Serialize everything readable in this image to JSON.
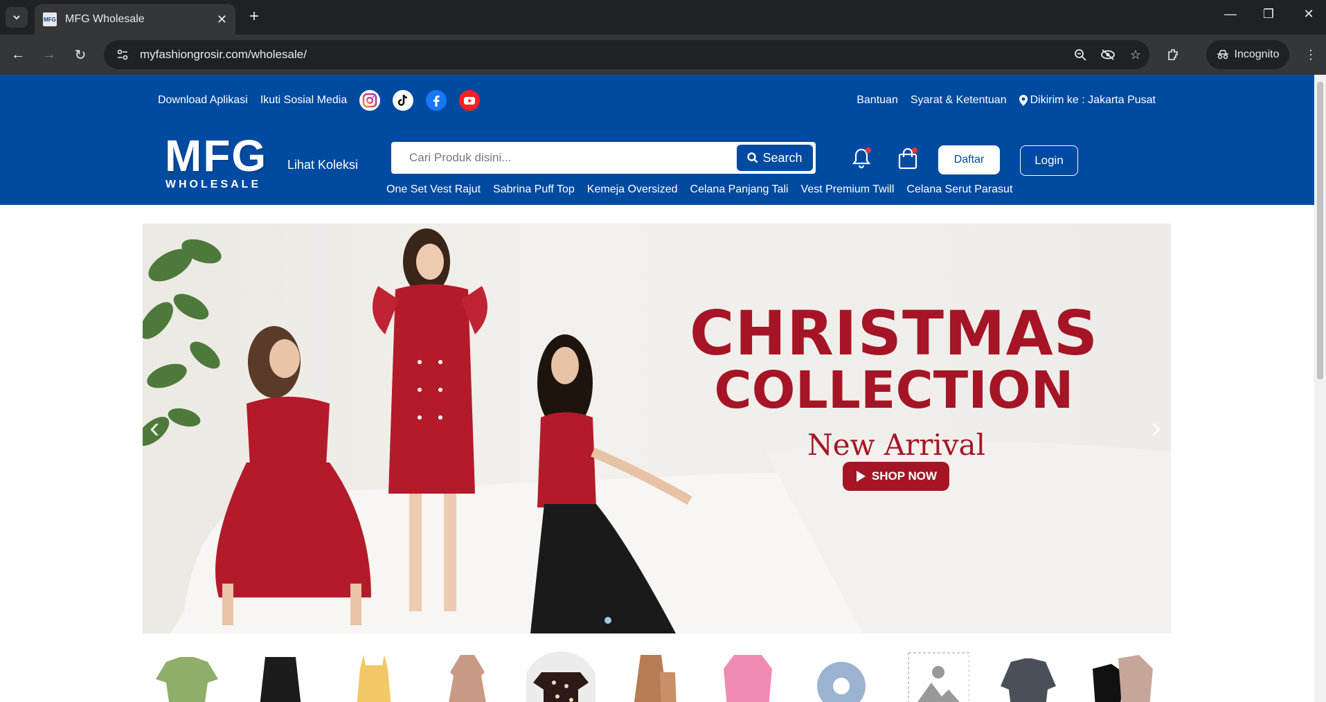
{
  "browser": {
    "tab_title": "MFG Wholesale",
    "favicon_text": "MFG",
    "url": "myfashiongrosir.com/wholesale/",
    "incognito_label": "Incognito"
  },
  "header": {
    "download_app": "Download Aplikasi",
    "follow_social": "Ikuti Sosial Media",
    "help": "Bantuan",
    "terms": "Syarat & Ketentuan",
    "ship_to": "Dikirim ke : Jakarta Pusat",
    "logo_main": "MFG",
    "logo_sub": "WHOLESALE",
    "see_collection": "Lihat Koleksi",
    "search_placeholder": "Cari Produk disini...",
    "search_button": "Search",
    "register": "Daftar",
    "login": "Login",
    "quick_links": [
      "One Set Vest Rajut",
      "Sabrina Puff Top",
      "Kemeja Oversized",
      "Celana Panjang Tali",
      "Vest Premium Twill",
      "Celana Serut Parasut"
    ]
  },
  "banner": {
    "line1": "CHRISTMAS",
    "line2": "COLLECTION",
    "subtitle": "New Arrival",
    "cta": "SHOP NOW"
  },
  "colors": {
    "brand_blue": "#004aa0",
    "accent_red": "#a51526"
  }
}
